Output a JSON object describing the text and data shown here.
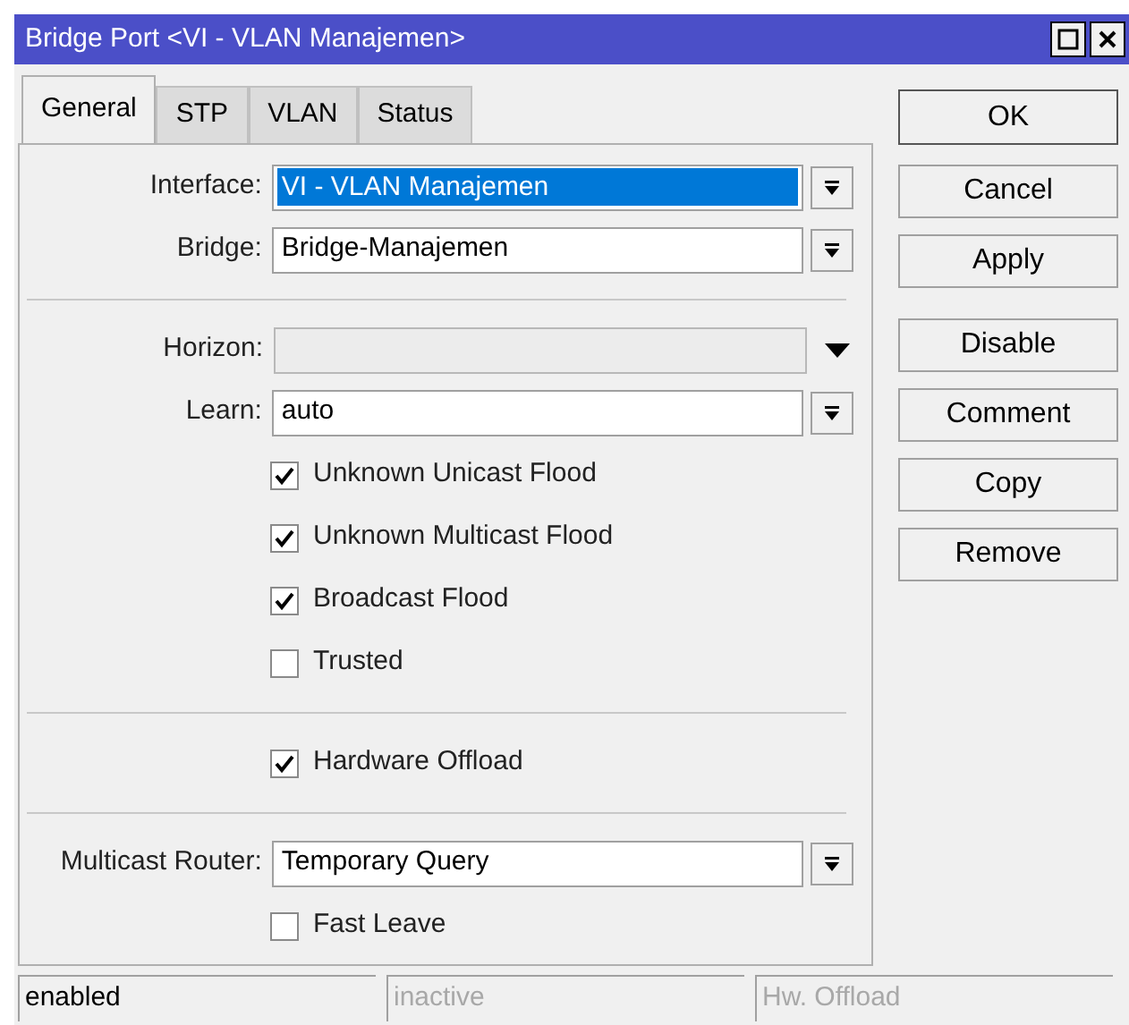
{
  "window": {
    "title": "Bridge Port <VI - VLAN Manajemen>"
  },
  "tabs": [
    {
      "label": "General",
      "selected": true
    },
    {
      "label": "STP",
      "selected": false
    },
    {
      "label": "VLAN",
      "selected": false
    },
    {
      "label": "Status",
      "selected": false
    }
  ],
  "fields": [
    {
      "kind": "select",
      "label": "Interface:",
      "value": "VI - VLAN Manajemen",
      "highlighted": true
    },
    {
      "kind": "select",
      "label": "Bridge:",
      "value": "Bridge-Manajemen",
      "highlighted": false
    },
    {
      "kind": "divider"
    },
    {
      "kind": "optional",
      "label": "Horizon:"
    },
    {
      "kind": "select",
      "label": "Learn:",
      "value": "auto",
      "highlighted": false
    },
    {
      "kind": "checkbox",
      "label": "Unknown Unicast Flood",
      "checked": true
    },
    {
      "kind": "checkbox",
      "label": "Unknown Multicast Flood",
      "checked": true
    },
    {
      "kind": "checkbox",
      "label": "Broadcast Flood",
      "checked": true
    },
    {
      "kind": "checkbox",
      "label": "Trusted",
      "checked": false
    },
    {
      "kind": "divider"
    },
    {
      "kind": "checkbox",
      "label": "Hardware Offload",
      "checked": true
    },
    {
      "kind": "divider"
    },
    {
      "kind": "select",
      "label": "Multicast Router:",
      "value": "Temporary Query",
      "highlighted": false
    },
    {
      "kind": "checkbox",
      "label": "Fast Leave",
      "checked": false
    }
  ],
  "buttons": [
    "OK",
    "Cancel",
    "Apply",
    "Disable",
    "Comment",
    "Copy",
    "Remove"
  ],
  "status_bar": [
    {
      "text": "enabled",
      "disabled": false
    },
    {
      "text": "inactive",
      "disabled": true
    },
    {
      "text": "Hw. Offload",
      "disabled": true
    }
  ]
}
